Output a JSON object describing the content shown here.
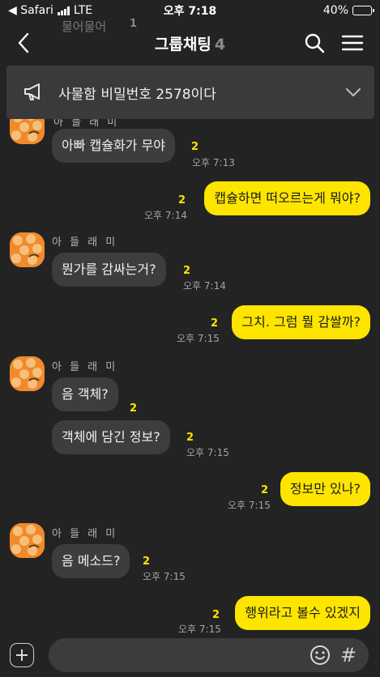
{
  "status_bar": {
    "back_app": "◀ Safari",
    "network": "LTE",
    "time": "오후 7:18",
    "battery": "40%",
    "battery_level": 0.4
  },
  "header": {
    "title": "그룹채팅",
    "member_count": "4",
    "back_icon": "chevron-left-icon",
    "search_icon": "search-icon",
    "menu_icon": "hamburger-menu-icon"
  },
  "notice": {
    "icon": "megaphone-icon",
    "text": "사물함 비밀번호 2578이다",
    "expand_icon": "chevron-down-icon"
  },
  "chat": {
    "partial_top": {
      "text": "물어물어",
      "unread": "1"
    },
    "partial_sender": "아 들 래 미",
    "messages": [
      {
        "type": "in",
        "text": "아빠 캡슐화가 무야",
        "unread": "2",
        "time": "오후 7:13"
      },
      {
        "type": "out",
        "text": "캡슐하면 떠오르는게 뭐야?",
        "unread": "2",
        "time": "오후 7:14"
      },
      {
        "type": "in",
        "sender": "아 들 래 미",
        "text": "뭔가를 감싸는거?",
        "unread": "2",
        "time": "오후 7:14"
      },
      {
        "type": "out",
        "text": "그치. 그럼 뭘 감쌀까?",
        "unread": "2",
        "time": "오후 7:15"
      },
      {
        "type": "in",
        "sender": "아 들 래 미",
        "text": "음 객체?",
        "unread": "2",
        "time": ""
      },
      {
        "type": "in",
        "text": "객체에 담긴 정보?",
        "unread": "2",
        "time": "오후 7:15"
      },
      {
        "type": "out",
        "text": "정보만 있나?",
        "unread": "2",
        "time": "오후 7:15"
      },
      {
        "type": "in",
        "sender": "아 들 래 미",
        "text": "음 메소드?",
        "unread": "2",
        "time": "오후 7:15"
      },
      {
        "type": "out",
        "text": "행위라고 볼수 있겠지",
        "unread": "2",
        "time": "오후 7:15"
      }
    ]
  },
  "input_bar": {
    "plus_icon": "plus-icon",
    "placeholder": "",
    "emoji_icon": "emoji-icon",
    "hash_label": "#"
  },
  "colors": {
    "background": "#232323",
    "incoming_bubble": "#3d3d3d",
    "outgoing_bubble": "#fee500",
    "unread": "#fee500",
    "notice_bg": "#3a3a3a"
  }
}
